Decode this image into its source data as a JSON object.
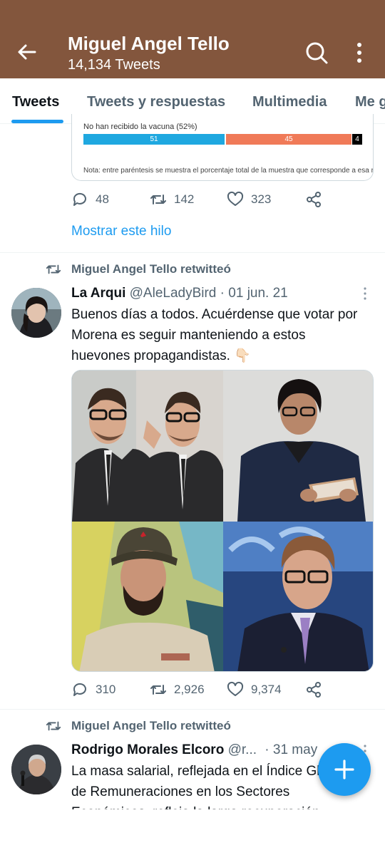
{
  "header": {
    "title": "Miguel Angel Tello",
    "subtitle": "14,134 Tweets",
    "back_icon": "arrow-left-icon",
    "search_icon": "search-icon",
    "more_icon": "more-vertical-icon",
    "background_color": "#83563d"
  },
  "tabs": [
    {
      "label": "Tweets",
      "active": true
    },
    {
      "label": "Tweets y respuestas",
      "active": false
    },
    {
      "label": "Multimedia",
      "active": false
    },
    {
      "label": "Me g",
      "active": false
    }
  ],
  "prev_tweet": {
    "poll_card": {
      "label": "No han recibido la vacuna (52%)",
      "bars": [
        {
          "value": "51",
          "color": "#1fa8e0"
        },
        {
          "value": "45",
          "color": "#f07a58"
        },
        {
          "value": "4",
          "color": "#000000"
        }
      ],
      "note": "Nota: entre paréntesis se muestra el porcentaje total de la muestra que corresponde a esa respuest"
    },
    "replies": "48",
    "retweets": "142",
    "likes": "323",
    "show_thread": "Mostrar este hilo"
  },
  "tweet1": {
    "retweet_by": "Miguel Angel Tello retwitteó",
    "name": "La Arqui",
    "handle": "@AleLadyBird",
    "date": "· 01 jun. 21",
    "text": "Buenos días a todos. Acuérdense que votar por Morena es seguir manteniendo a estos huevones propagandistas. 👇🏻",
    "replies": "310",
    "retweets": "2,926",
    "likes": "9,374"
  },
  "tweet2": {
    "retweet_by": "Miguel Angel Tello retwitteó",
    "name": "Rodrigo Morales Elcoro",
    "handle": "@r...",
    "date": "· 31 may",
    "text": "La masa salarial, reflejada en el Índice Global de Remuneraciones en los Sectores Económicos, refleja la larga recuperación"
  },
  "fab": {
    "icon": "compose-plus-icon",
    "color": "#1d9bf0"
  }
}
